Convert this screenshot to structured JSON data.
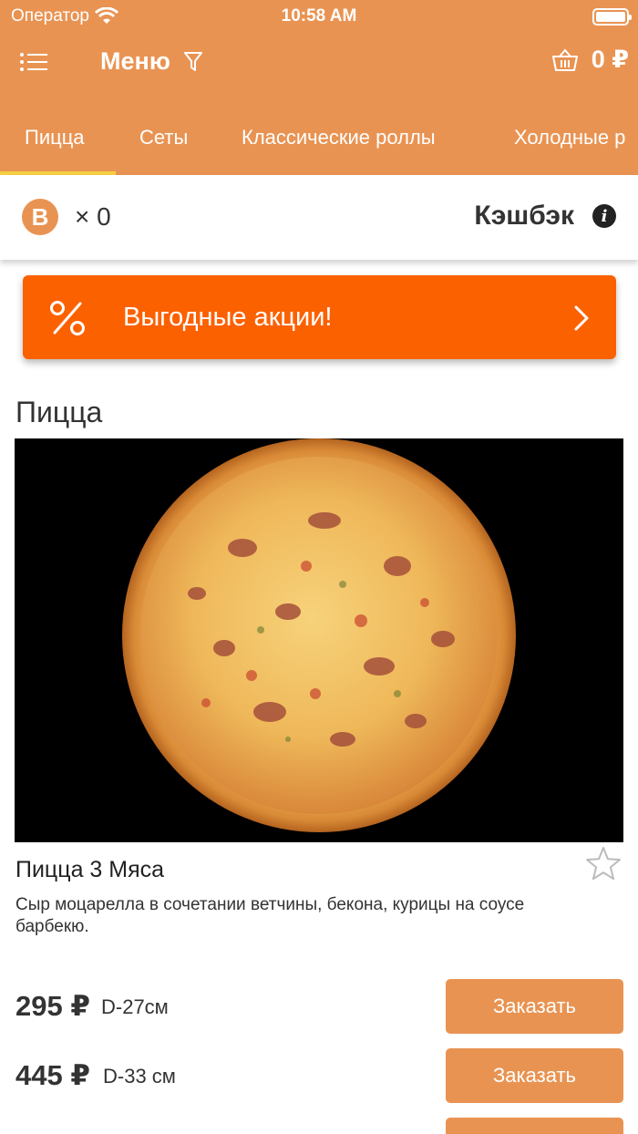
{
  "status_bar": {
    "carrier": "Оператор",
    "time": "10:58 AM"
  },
  "navbar": {
    "title": "Меню",
    "cart_total": "0 ₽"
  },
  "tabs": [
    {
      "label": "Пицца",
      "active": true
    },
    {
      "label": "Сеты",
      "active": false
    },
    {
      "label": "Классические роллы",
      "active": false
    },
    {
      "label": "Холодные р",
      "active": false
    }
  ],
  "cashback": {
    "coin_letter": "B",
    "coin_count": "× 0",
    "label": "Кэшбэк"
  },
  "promo": {
    "label": "Выгодные акции!"
  },
  "section": {
    "title": "Пицца"
  },
  "product": {
    "name": "Пицца 3 Мяса",
    "description": "Сыр моцарелла в сочетании ветчины, бекона, курицы на соусе барбекю.",
    "options": [
      {
        "price": "295 ₽",
        "size": "D-27см",
        "button": "Заказать"
      },
      {
        "price": "445 ₽",
        "size": "D-33 см",
        "button": "Заказать"
      }
    ]
  },
  "colors": {
    "header": "#e99352",
    "promo": "#fc6100",
    "tab_indicator": "#f6d043"
  },
  "icons": [
    "menu-list-icon",
    "filter-icon",
    "basket-icon",
    "info-icon",
    "percent-icon",
    "chevron-right-icon",
    "star-outline-icon",
    "wifi-icon",
    "battery-icon"
  ]
}
